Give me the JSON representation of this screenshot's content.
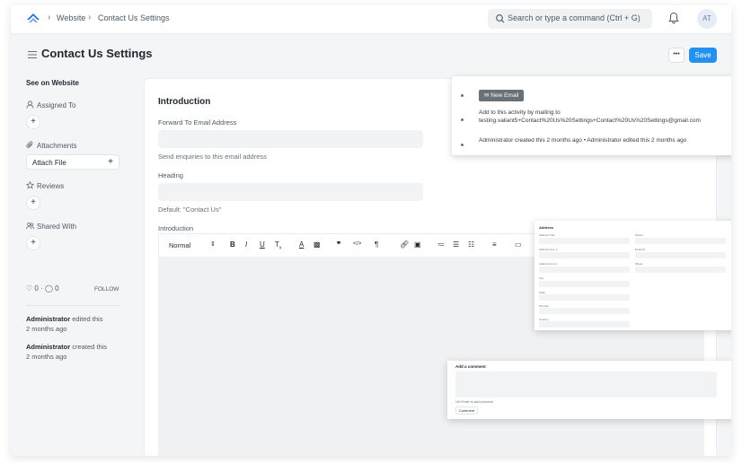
{
  "navbar": {
    "breadcrumbs": [
      "Website",
      "Contact Us Settings"
    ],
    "search_placeholder": "Search or type a command (Ctrl + G)",
    "avatar_initials": "AT"
  },
  "page": {
    "title": "Contact Us Settings",
    "more_label": "•••",
    "save_label": "Save"
  },
  "sidebar": {
    "see_on_website": "See on Website",
    "assigned_to": "Assigned To",
    "attachments": "Attachments",
    "attach_file": "Attach File",
    "reviews": "Reviews",
    "shared_with": "Shared With",
    "likes": "0",
    "comments": "0",
    "follow": "FOLLOW",
    "activity": [
      {
        "user": "Administrator",
        "action": "edited this",
        "time": "2 months ago"
      },
      {
        "user": "Administrator",
        "action": "created this",
        "time": "2 months ago"
      }
    ]
  },
  "form": {
    "section_title": "Introduction",
    "forward_label": "Forward To Email Address",
    "forward_value": "",
    "forward_desc": "Send enquiries to this email address",
    "heading_label": "Heading",
    "heading_value": "",
    "heading_desc": "Default: \"Contact Us\"",
    "intro_label": "Introduction",
    "editor_format": "Normal"
  },
  "timeline": {
    "new_email": "New Email",
    "mail_hint": "Add to this activity by mailing to",
    "mail_address": "testing.valiant5+Contact%20Us%20Settings+Contact%20Us%20Settings@gmail.com",
    "log": "Administrator created this 2 months ago • Administrator edited this 2 months ago"
  },
  "address_form": {
    "title": "Address",
    "left_fields": [
      "Address Title",
      "Address Line 1",
      "Address Line 2",
      "City",
      "State",
      "Pincode",
      "Country"
    ],
    "right_fields": [
      "Phone",
      "Email Id",
      "Skype"
    ]
  },
  "comment": {
    "title": "Add a comment",
    "hint": "Ctrl+Enter to add comment",
    "button": "Comment"
  },
  "colors": {
    "primary": "#2490ef",
    "background": "#f4f5f6",
    "input_bg": "#f2f3f4"
  }
}
